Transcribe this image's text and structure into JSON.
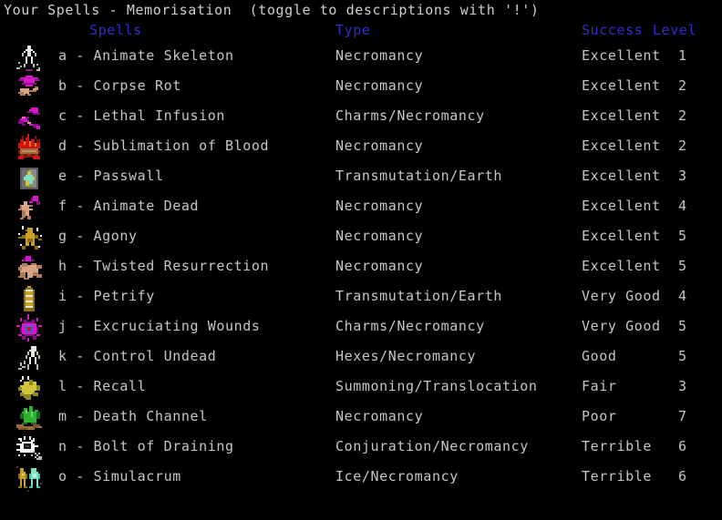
{
  "window": {
    "title": "Your Spells - Memorisation  (toggle to descriptions with '!')",
    "background": "#000000",
    "text_color": "#c6c6c6",
    "header_color": "#2f2fc8"
  },
  "columns": {
    "spells": "Spells",
    "type": "Type",
    "success": "Success",
    "level": "Level"
  },
  "spells": [
    {
      "letter": "a",
      "name": "a - Animate Skeleton",
      "type": "Necromancy",
      "success": "Excellent",
      "level": "1",
      "icon": "skeleton-icon"
    },
    {
      "letter": "b",
      "name": "b - Corpse Rot",
      "type": "Necromancy",
      "success": "Excellent",
      "level": "2",
      "icon": "rotting-corpse-icon"
    },
    {
      "letter": "c",
      "name": "c - Lethal Infusion",
      "type": "Charms/Necromancy",
      "success": "Excellent",
      "level": "2",
      "icon": "infused-blade-icon"
    },
    {
      "letter": "d",
      "name": "d - Sublimation of Blood",
      "type": "Necromancy",
      "success": "Excellent",
      "level": "2",
      "icon": "burning-log-icon"
    },
    {
      "letter": "e",
      "name": "e - Passwall",
      "type": "Transmutation/Earth",
      "success": "Excellent",
      "level": "3",
      "icon": "figure-in-wall-icon"
    },
    {
      "letter": "f",
      "name": "f - Animate Dead",
      "type": "Necromancy",
      "success": "Excellent",
      "level": "4",
      "icon": "raised-zombie-icon"
    },
    {
      "letter": "g",
      "name": "g - Agony",
      "type": "Necromancy",
      "success": "Excellent",
      "level": "5",
      "icon": "writhing-figure-icon"
    },
    {
      "letter": "h",
      "name": "h - Twisted Resurrection",
      "type": "Necromancy",
      "success": "Excellent",
      "level": "5",
      "icon": "abomination-icon"
    },
    {
      "letter": "i",
      "name": "i - Petrify",
      "type": "Transmutation/Earth",
      "success": "Very Good",
      "level": "4",
      "icon": "stone-pillar-icon"
    },
    {
      "letter": "j",
      "name": "j - Excruciating Wounds",
      "type": "Charms/Necromancy",
      "success": "Very Good",
      "level": "5",
      "icon": "burst-wound-icon"
    },
    {
      "letter": "k",
      "name": "k - Control Undead",
      "type": "Hexes/Necromancy",
      "success": "Good",
      "level": "5",
      "icon": "commanded-skeleton-icon"
    },
    {
      "letter": "l",
      "name": "l - Recall",
      "type": "Summoning/Translocation",
      "success": "Fair",
      "level": "3",
      "icon": "yellow-hand-icon"
    },
    {
      "letter": "m",
      "name": "m - Death Channel",
      "type": "Necromancy",
      "success": "Poor",
      "level": "7",
      "icon": "green-spirit-icon"
    },
    {
      "letter": "n",
      "name": "n - Bolt of Draining",
      "type": "Conjuration/Necromancy",
      "success": "Terrible",
      "level": "6",
      "icon": "draining-bolt-icon"
    },
    {
      "letter": "o",
      "name": "o - Simulacrum",
      "type": "Ice/Necromancy",
      "success": "Terrible",
      "level": "6",
      "icon": "twin-figures-icon"
    }
  ]
}
